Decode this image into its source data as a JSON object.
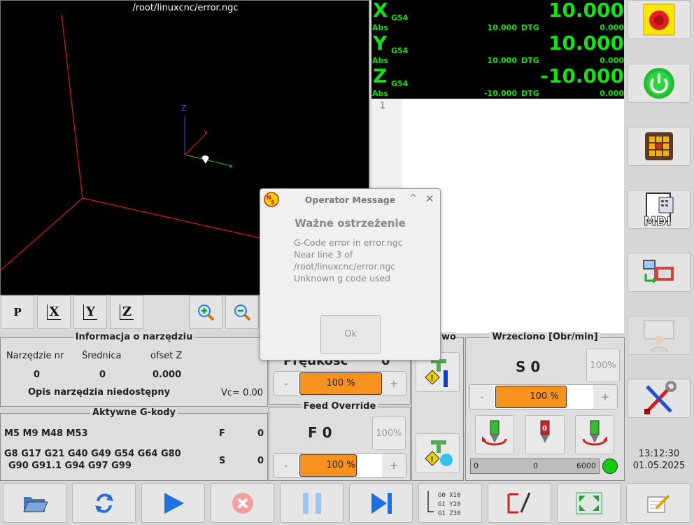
{
  "preview": {
    "file_title": "/root/linuxcnc/error.ngc",
    "axis_z": "Z"
  },
  "view_buttons": {
    "x": "X",
    "y": "Y",
    "z": "Z",
    "p": "P"
  },
  "dro": {
    "axes": [
      {
        "letter": "X",
        "offset": "G54",
        "value": "10.000",
        "abs_label": "Abs",
        "abs": "10.000",
        "dtg_label": "DTG",
        "dtg": "0.000"
      },
      {
        "letter": "Y",
        "offset": "G54",
        "value": "10.000",
        "abs_label": "Abs",
        "abs": "10.000",
        "dtg_label": "DTG",
        "dtg": "0.000"
      },
      {
        "letter": "Z",
        "offset": "G54",
        "value": "-10.000",
        "abs_label": "Abs",
        "abs": "-10.000",
        "dtg_label": "DTG",
        "dtg": "0.000"
      }
    ],
    "color": "#16e016"
  },
  "gcode": {
    "line_number": "1"
  },
  "tool": {
    "title": "Informacja o narzędziu",
    "col_tool": "Narzędzie nr",
    "col_diam": "Średnica",
    "col_offset": "ofset Z",
    "tool_nr": "0",
    "diameter": "0",
    "offset_z": "0.000",
    "desc": "Opis narzędzia niedostępny",
    "vc": "Vc= 0.00"
  },
  "gcodes": {
    "title": "Aktywne G-kody",
    "mcodes": "M5 M9 M48 M53",
    "gcodes_line1": "G8 G17 G21 G40 G49 G54 G64 G80",
    "gcodes_line2": "G90 G91.1 G94 G97 G99",
    "f_label": "F",
    "f_value": "0",
    "s_label": "S",
    "s_value": "0"
  },
  "speed": {
    "title": "Prędkość",
    "value": "0",
    "pct": "100 %",
    "level": 1.0,
    "minus": "-",
    "plus": "+"
  },
  "feed": {
    "title": "Feed Override",
    "value": "F  0",
    "reset": "100%",
    "pct": "100 %",
    "level": 1.0,
    "minus": "-",
    "plus": "+"
  },
  "coolant": {
    "title_partial": "ziwo"
  },
  "spindle": {
    "title": "Wrzeciono [Obr/min]",
    "value": "S 0",
    "reset": "100%",
    "pct": "100 %",
    "level": 1.0,
    "minus": "-",
    "plus": "+",
    "bar_min": "0",
    "bar_val": "0",
    "bar_max": "6000",
    "status_color": "#11cc11"
  },
  "clock": {
    "time": "13:12:30",
    "date": "01.05.2025"
  },
  "dialog": {
    "title": "Operator Message",
    "heading": "Ważne ostrzeżenie",
    "lines": [
      "G-Code error in error.ngc",
      "Near line 3 of",
      "/root/linuxcnc/error.ngc",
      "Unknown g code used"
    ],
    "ok": "Ok"
  },
  "gcode_icon": {
    "l1": "G0  X10",
    "l2": "G1  Y20",
    "l3": "G1  Z30"
  },
  "mdi_label": "MDI",
  "accent": "#f7921e"
}
